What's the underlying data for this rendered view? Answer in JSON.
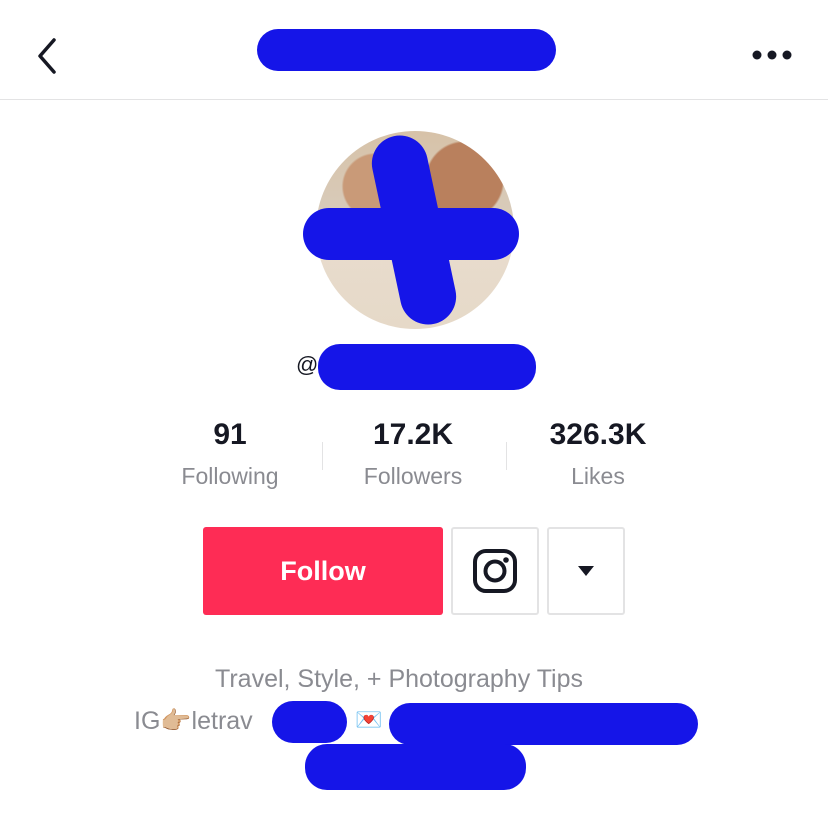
{
  "header": {
    "back_icon": "chevron-left-icon",
    "more_icon": "more-horizontal-icon"
  },
  "profile": {
    "at_symbol": "@"
  },
  "stats": [
    {
      "value": "91",
      "label": "Following"
    },
    {
      "value": "17.2K",
      "label": "Followers"
    },
    {
      "value": "326.3K",
      "label": "Likes"
    }
  ],
  "actions": {
    "follow_label": "Follow",
    "instagram_icon": "instagram-icon",
    "dropdown_icon": "triangle-down-icon",
    "follow_color": "#fe2c55"
  },
  "bio": {
    "line1": "Travel, Style, + Photography Tips",
    "line2_prefix": "IG",
    "line2_pointer": "👉🏼",
    "line2_text": "letrav",
    "line2_envelope": "💌"
  },
  "colors": {
    "redaction": "#1515e8",
    "muted_text": "#8a8b91",
    "primary_text": "#161823"
  }
}
